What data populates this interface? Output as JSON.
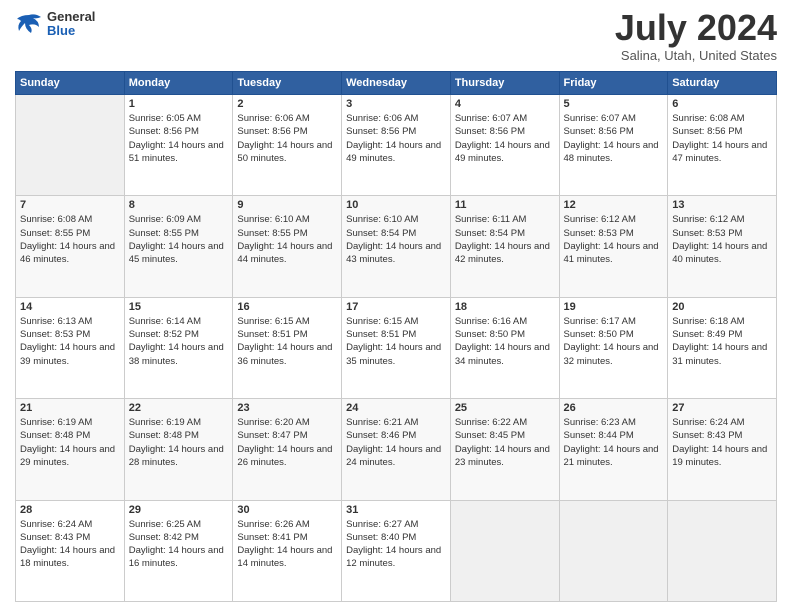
{
  "header": {
    "logo": {
      "general": "General",
      "blue": "Blue"
    },
    "title": "July 2024",
    "location": "Salina, Utah, United States"
  },
  "days_of_week": [
    "Sunday",
    "Monday",
    "Tuesday",
    "Wednesday",
    "Thursday",
    "Friday",
    "Saturday"
  ],
  "weeks": [
    [
      {
        "day": "",
        "sunrise": "",
        "sunset": "",
        "daylight": "",
        "empty": true
      },
      {
        "day": "1",
        "sunrise": "Sunrise: 6:05 AM",
        "sunset": "Sunset: 8:56 PM",
        "daylight": "Daylight: 14 hours and 51 minutes."
      },
      {
        "day": "2",
        "sunrise": "Sunrise: 6:06 AM",
        "sunset": "Sunset: 8:56 PM",
        "daylight": "Daylight: 14 hours and 50 minutes."
      },
      {
        "day": "3",
        "sunrise": "Sunrise: 6:06 AM",
        "sunset": "Sunset: 8:56 PM",
        "daylight": "Daylight: 14 hours and 49 minutes."
      },
      {
        "day": "4",
        "sunrise": "Sunrise: 6:07 AM",
        "sunset": "Sunset: 8:56 PM",
        "daylight": "Daylight: 14 hours and 49 minutes."
      },
      {
        "day": "5",
        "sunrise": "Sunrise: 6:07 AM",
        "sunset": "Sunset: 8:56 PM",
        "daylight": "Daylight: 14 hours and 48 minutes."
      },
      {
        "day": "6",
        "sunrise": "Sunrise: 6:08 AM",
        "sunset": "Sunset: 8:56 PM",
        "daylight": "Daylight: 14 hours and 47 minutes."
      }
    ],
    [
      {
        "day": "7",
        "sunrise": "Sunrise: 6:08 AM",
        "sunset": "Sunset: 8:55 PM",
        "daylight": "Daylight: 14 hours and 46 minutes."
      },
      {
        "day": "8",
        "sunrise": "Sunrise: 6:09 AM",
        "sunset": "Sunset: 8:55 PM",
        "daylight": "Daylight: 14 hours and 45 minutes."
      },
      {
        "day": "9",
        "sunrise": "Sunrise: 6:10 AM",
        "sunset": "Sunset: 8:55 PM",
        "daylight": "Daylight: 14 hours and 44 minutes."
      },
      {
        "day": "10",
        "sunrise": "Sunrise: 6:10 AM",
        "sunset": "Sunset: 8:54 PM",
        "daylight": "Daylight: 14 hours and 43 minutes."
      },
      {
        "day": "11",
        "sunrise": "Sunrise: 6:11 AM",
        "sunset": "Sunset: 8:54 PM",
        "daylight": "Daylight: 14 hours and 42 minutes."
      },
      {
        "day": "12",
        "sunrise": "Sunrise: 6:12 AM",
        "sunset": "Sunset: 8:53 PM",
        "daylight": "Daylight: 14 hours and 41 minutes."
      },
      {
        "day": "13",
        "sunrise": "Sunrise: 6:12 AM",
        "sunset": "Sunset: 8:53 PM",
        "daylight": "Daylight: 14 hours and 40 minutes."
      }
    ],
    [
      {
        "day": "14",
        "sunrise": "Sunrise: 6:13 AM",
        "sunset": "Sunset: 8:53 PM",
        "daylight": "Daylight: 14 hours and 39 minutes."
      },
      {
        "day": "15",
        "sunrise": "Sunrise: 6:14 AM",
        "sunset": "Sunset: 8:52 PM",
        "daylight": "Daylight: 14 hours and 38 minutes."
      },
      {
        "day": "16",
        "sunrise": "Sunrise: 6:15 AM",
        "sunset": "Sunset: 8:51 PM",
        "daylight": "Daylight: 14 hours and 36 minutes."
      },
      {
        "day": "17",
        "sunrise": "Sunrise: 6:15 AM",
        "sunset": "Sunset: 8:51 PM",
        "daylight": "Daylight: 14 hours and 35 minutes."
      },
      {
        "day": "18",
        "sunrise": "Sunrise: 6:16 AM",
        "sunset": "Sunset: 8:50 PM",
        "daylight": "Daylight: 14 hours and 34 minutes."
      },
      {
        "day": "19",
        "sunrise": "Sunrise: 6:17 AM",
        "sunset": "Sunset: 8:50 PM",
        "daylight": "Daylight: 14 hours and 32 minutes."
      },
      {
        "day": "20",
        "sunrise": "Sunrise: 6:18 AM",
        "sunset": "Sunset: 8:49 PM",
        "daylight": "Daylight: 14 hours and 31 minutes."
      }
    ],
    [
      {
        "day": "21",
        "sunrise": "Sunrise: 6:19 AM",
        "sunset": "Sunset: 8:48 PM",
        "daylight": "Daylight: 14 hours and 29 minutes."
      },
      {
        "day": "22",
        "sunrise": "Sunrise: 6:19 AM",
        "sunset": "Sunset: 8:48 PM",
        "daylight": "Daylight: 14 hours and 28 minutes."
      },
      {
        "day": "23",
        "sunrise": "Sunrise: 6:20 AM",
        "sunset": "Sunset: 8:47 PM",
        "daylight": "Daylight: 14 hours and 26 minutes."
      },
      {
        "day": "24",
        "sunrise": "Sunrise: 6:21 AM",
        "sunset": "Sunset: 8:46 PM",
        "daylight": "Daylight: 14 hours and 24 minutes."
      },
      {
        "day": "25",
        "sunrise": "Sunrise: 6:22 AM",
        "sunset": "Sunset: 8:45 PM",
        "daylight": "Daylight: 14 hours and 23 minutes."
      },
      {
        "day": "26",
        "sunrise": "Sunrise: 6:23 AM",
        "sunset": "Sunset: 8:44 PM",
        "daylight": "Daylight: 14 hours and 21 minutes."
      },
      {
        "day": "27",
        "sunrise": "Sunrise: 6:24 AM",
        "sunset": "Sunset: 8:43 PM",
        "daylight": "Daylight: 14 hours and 19 minutes."
      }
    ],
    [
      {
        "day": "28",
        "sunrise": "Sunrise: 6:24 AM",
        "sunset": "Sunset: 8:43 PM",
        "daylight": "Daylight: 14 hours and 18 minutes."
      },
      {
        "day": "29",
        "sunrise": "Sunrise: 6:25 AM",
        "sunset": "Sunset: 8:42 PM",
        "daylight": "Daylight: 14 hours and 16 minutes."
      },
      {
        "day": "30",
        "sunrise": "Sunrise: 6:26 AM",
        "sunset": "Sunset: 8:41 PM",
        "daylight": "Daylight: 14 hours and 14 minutes."
      },
      {
        "day": "31",
        "sunrise": "Sunrise: 6:27 AM",
        "sunset": "Sunset: 8:40 PM",
        "daylight": "Daylight: 14 hours and 12 minutes."
      },
      {
        "day": "",
        "sunrise": "",
        "sunset": "",
        "daylight": "",
        "empty": true
      },
      {
        "day": "",
        "sunrise": "",
        "sunset": "",
        "daylight": "",
        "empty": true
      },
      {
        "day": "",
        "sunrise": "",
        "sunset": "",
        "daylight": "",
        "empty": true
      }
    ]
  ]
}
